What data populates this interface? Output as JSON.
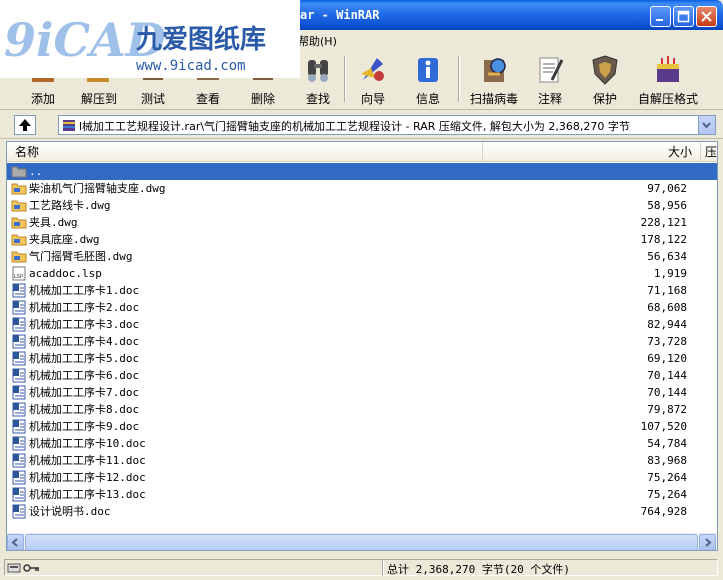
{
  "window": {
    "title": "ar - WinRAR"
  },
  "logo": {
    "brand_text": "九爱图纸库",
    "site_text": "www.9icad.com",
    "mark_text": "9iCAD"
  },
  "menu": {
    "help_label": "帮助(H)"
  },
  "toolbar": {
    "buttons": [
      {
        "label": "添加",
        "icon": "add-icon"
      },
      {
        "label": "解压到",
        "icon": "extract-to-icon"
      },
      {
        "label": "测试",
        "icon": "test-icon"
      },
      {
        "label": "查看",
        "icon": "view-icon"
      },
      {
        "label": "删除",
        "icon": "delete-icon"
      },
      {
        "label": "查找",
        "icon": "find-icon"
      },
      {
        "label": "向导",
        "icon": "wizard-icon"
      },
      {
        "label": "信息",
        "icon": "info-icon"
      },
      {
        "label": "扫描病毒",
        "icon": "virus-scan-icon"
      },
      {
        "label": "注释",
        "icon": "comment-icon"
      },
      {
        "label": "保护",
        "icon": "protect-icon"
      },
      {
        "label": "自解压格式",
        "icon": "sfx-icon"
      }
    ]
  },
  "address": {
    "path": "l械加工工艺规程设计.rar\\气门摇臂轴支座的机械加工工艺规程设计 - RAR 压缩文件, 解包大小为 2,368,270 字节"
  },
  "list": {
    "columns": [
      "名称",
      "大小",
      "压"
    ],
    "parent_row": "..",
    "files": [
      {
        "name": "柴油机气门摇臂轴支座.dwg",
        "size": "97,062",
        "type": "dwg"
      },
      {
        "name": "工艺路线卡.dwg",
        "size": "58,956",
        "type": "dwg"
      },
      {
        "name": "夹具.dwg",
        "size": "228,121",
        "type": "dwg"
      },
      {
        "name": "夹具底座.dwg",
        "size": "178,122",
        "type": "dwg"
      },
      {
        "name": "气门摇臂毛胚图.dwg",
        "size": "56,634",
        "type": "dwg"
      },
      {
        "name": "acaddoc.lsp",
        "size": "1,919",
        "type": "lsp"
      },
      {
        "name": "机械加工工序卡1.doc",
        "size": "71,168",
        "type": "doc"
      },
      {
        "name": "机械加工工序卡2.doc",
        "size": "68,608",
        "type": "doc"
      },
      {
        "name": "机械加工工序卡3.doc",
        "size": "82,944",
        "type": "doc"
      },
      {
        "name": "机械加工工序卡4.doc",
        "size": "73,728",
        "type": "doc"
      },
      {
        "name": "机械加工工序卡5.doc",
        "size": "69,120",
        "type": "doc"
      },
      {
        "name": "机械加工工序卡6.doc",
        "size": "70,144",
        "type": "doc"
      },
      {
        "name": "机械加工工序卡7.doc",
        "size": "70,144",
        "type": "doc"
      },
      {
        "name": "机械加工工序卡8.doc",
        "size": "79,872",
        "type": "doc"
      },
      {
        "name": "机械加工工序卡9.doc",
        "size": "107,520",
        "type": "doc"
      },
      {
        "name": "机械加工工序卡10.doc",
        "size": "54,784",
        "type": "doc"
      },
      {
        "name": "机械加工工序卡11.doc",
        "size": "83,968",
        "type": "doc"
      },
      {
        "name": "机械加工工序卡12.doc",
        "size": "75,264",
        "type": "doc"
      },
      {
        "name": "机械加工工序卡13.doc",
        "size": "75,264",
        "type": "doc"
      },
      {
        "name": "设计说明书.doc",
        "size": "764,928",
        "type": "doc"
      }
    ]
  },
  "status": {
    "summary": "总计 2,368,270 字节(20 个文件)"
  },
  "colors": {
    "title_blue": "#1f68e4",
    "selection": "#316ac5",
    "face": "#ece9d8"
  }
}
